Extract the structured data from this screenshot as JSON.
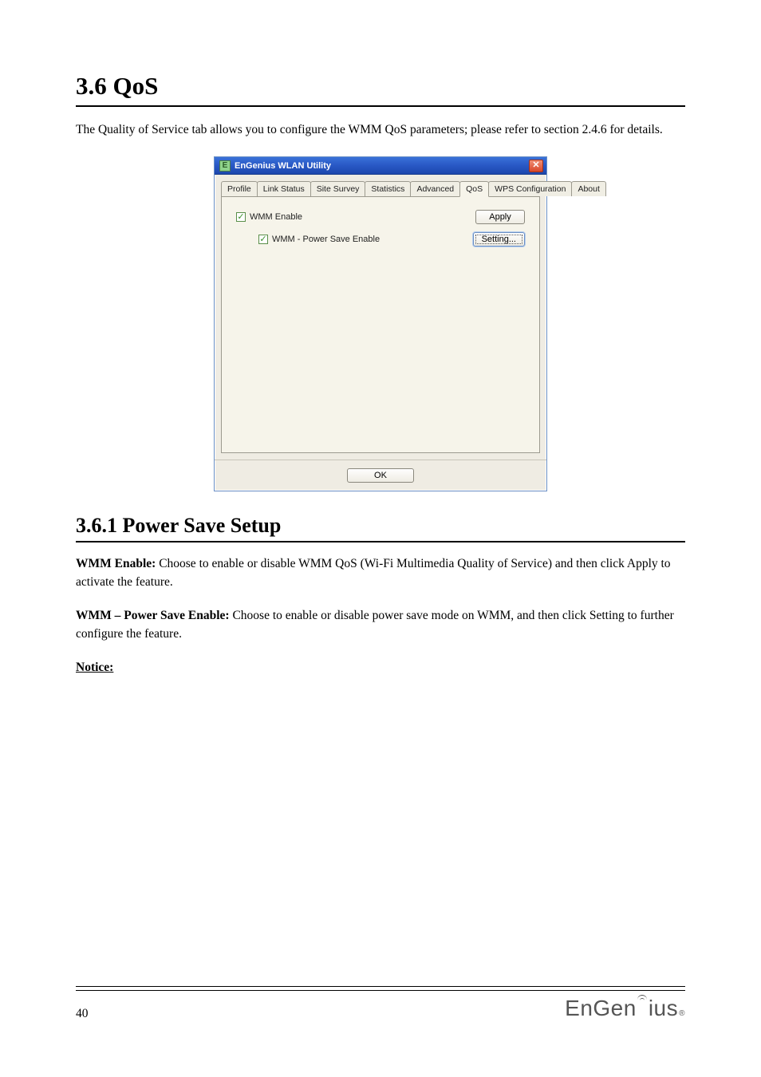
{
  "section": {
    "number": "3.6",
    "title": "QoS",
    "intro": "The Quality of Service tab allows you to configure the WMM QoS parameters; please refer to section 2.4.6 for details."
  },
  "dialog": {
    "title": "EnGenius WLAN Utility",
    "tabs": [
      {
        "label": "Profile"
      },
      {
        "label": "Link Status"
      },
      {
        "label": "Site Survey"
      },
      {
        "label": "Statistics"
      },
      {
        "label": "Advanced"
      },
      {
        "label": "QoS"
      },
      {
        "label": "WPS Configuration"
      },
      {
        "label": "About"
      }
    ],
    "wmm_enable_label": "WMM Enable",
    "wmm_ps_label": "WMM - Power Save Enable",
    "apply_label": "Apply",
    "setting_label": "Setting...",
    "ok_label": "OK",
    "wmm_enable_checked": true,
    "wmm_ps_checked": true
  },
  "subsection": {
    "number": "3.6.1",
    "title": "Power Save Setup"
  },
  "paragraphs": {
    "p1_label": "WMM Enable:",
    "p1_text": " Choose to enable or disable WMM QoS (Wi-Fi Multimedia Quality of Service) and then click Apply to activate the feature.",
    "p2_label": "WMM – Power Save Enable:",
    "p2_text": " Choose to enable or disable power save mode on WMM, and then click Setting to further configure the feature."
  },
  "note_label": "Notice:",
  "footer": {
    "page": "40",
    "brand": "EnGenius"
  }
}
